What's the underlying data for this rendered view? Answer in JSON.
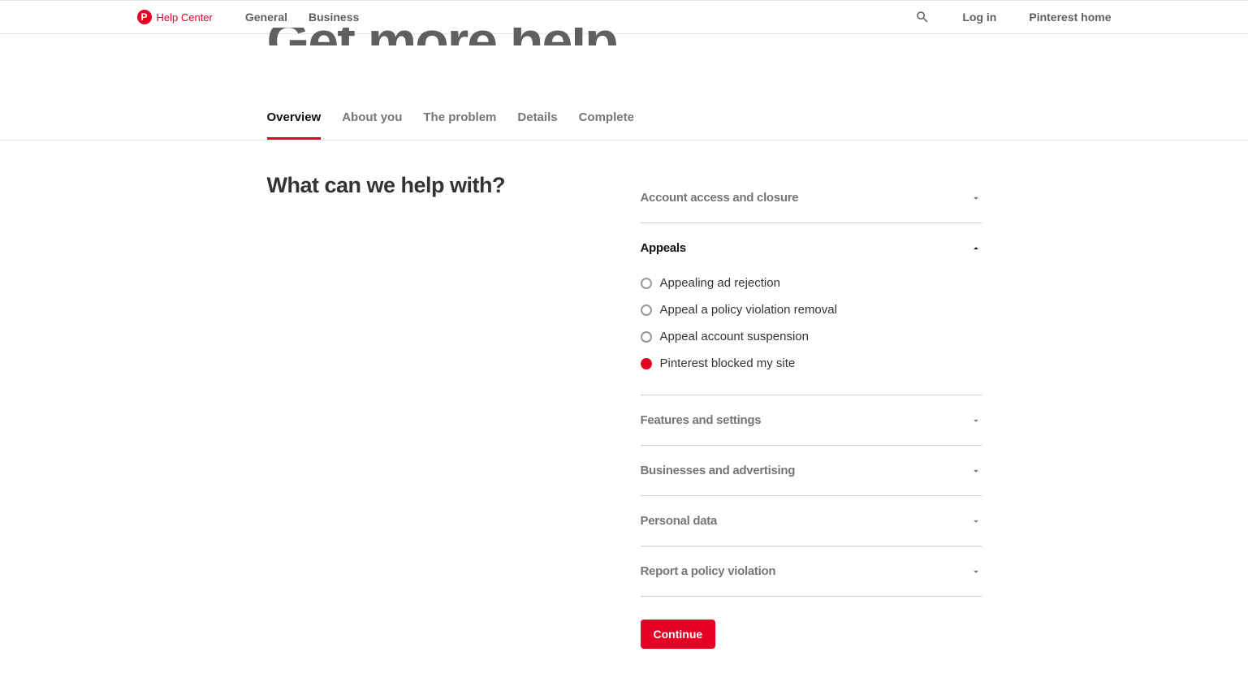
{
  "header": {
    "logo_text": "Help Center",
    "nav": [
      "General",
      "Business"
    ],
    "login": "Log in",
    "home": "Pinterest home"
  },
  "hero_cut": "Get more help",
  "tabs": [
    "Overview",
    "About you",
    "The problem",
    "Details",
    "Complete"
  ],
  "active_tab": 0,
  "question": "What can we help with?",
  "categories": [
    {
      "title": "Account access and closure",
      "expanded": false
    },
    {
      "title": "Appeals",
      "expanded": true,
      "options": [
        {
          "label": "Appealing ad rejection",
          "selected": false
        },
        {
          "label": "Appeal a policy violation removal",
          "selected": false
        },
        {
          "label": "Appeal account suspension",
          "selected": false
        },
        {
          "label": "Pinterest blocked my site",
          "selected": true
        }
      ]
    },
    {
      "title": "Features and settings",
      "expanded": false
    },
    {
      "title": "Businesses and advertising",
      "expanded": false
    },
    {
      "title": "Personal data",
      "expanded": false
    },
    {
      "title": "Report a policy violation",
      "expanded": false
    }
  ],
  "continue": "Continue"
}
